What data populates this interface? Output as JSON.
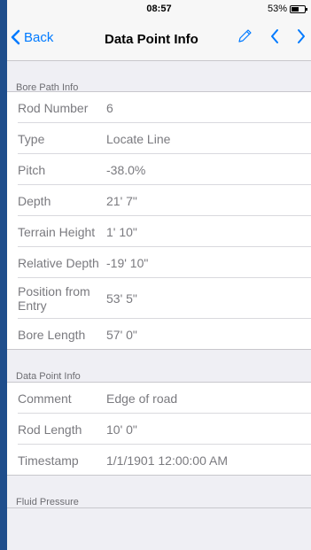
{
  "status": {
    "time": "08:57",
    "battery": "53%",
    "battery_level": 0.53
  },
  "nav": {
    "back_label": "Back",
    "title": "Data Point Info"
  },
  "sections": [
    {
      "header": "Bore Path Info",
      "rows": [
        {
          "label": "Rod Number",
          "value": "6"
        },
        {
          "label": "Type",
          "value": "Locate Line"
        },
        {
          "label": "Pitch",
          "value": "-38.0%"
        },
        {
          "label": "Depth",
          "value": "21' 7\""
        },
        {
          "label": "Terrain Height",
          "value": "1' 10\""
        },
        {
          "label": "Relative Depth",
          "value": "-19' 10\""
        },
        {
          "label": "Position from Entry",
          "value": "53' 5\""
        },
        {
          "label": "Bore Length",
          "value": "57' 0\""
        }
      ]
    },
    {
      "header": "Data Point Info",
      "rows": [
        {
          "label": "Comment",
          "value": "Edge of road"
        },
        {
          "label": "Rod Length",
          "value": "10' 0\""
        },
        {
          "label": "Timestamp",
          "value": "1/1/1901 12:00:00 AM"
        }
      ]
    },
    {
      "header": "Fluid Pressure",
      "rows": []
    }
  ],
  "colors": {
    "accent": "#007aff",
    "frame": "#1f4e8c"
  },
  "icons": [
    "chevron-left-icon",
    "pencil-icon",
    "chevron-right-icon",
    "battery-icon"
  ]
}
